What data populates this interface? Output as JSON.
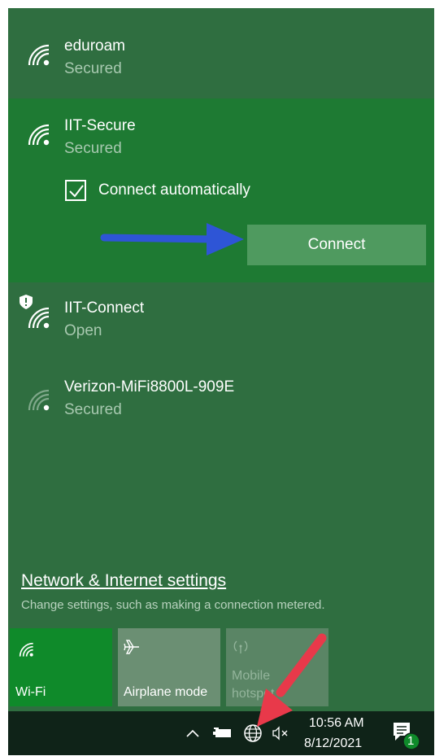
{
  "networks": [
    {
      "ssid": "eduroam",
      "status": "Secured"
    },
    {
      "ssid": "IIT-Secure",
      "status": "Secured"
    },
    {
      "ssid": "IIT-Connect",
      "status": "Open"
    },
    {
      "ssid": "Verizon-MiFi8800L-909E",
      "status": "Secured"
    }
  ],
  "selected": {
    "auto_connect_label": "Connect automatically",
    "auto_connect_checked": true,
    "connect_label": "Connect"
  },
  "settings": {
    "link": "Network & Internet settings",
    "description": "Change settings, such as making a connection metered."
  },
  "quick_actions": {
    "wifi_label": "Wi-Fi",
    "airplane_label": "Airplane mode",
    "mobile_label_line1": "Mobile",
    "mobile_label_line2": "hotspot"
  },
  "taskbar": {
    "time": "10:56 AM",
    "date": "8/12/2021",
    "notification_count": "1",
    "icons": [
      "chevron-up-icon",
      "battery-icon",
      "globe-network-icon",
      "speaker-muted-icon",
      "notification-icon"
    ]
  },
  "colors": {
    "flyout_bg": "#2f6e40",
    "selected_bg": "#1e7a33",
    "connect_button": "#4f9a5f",
    "wifi_tile_active": "#0f8a2a",
    "taskbar_bg": "#0f2318",
    "annotation_blue": "#2e55d6",
    "annotation_red": "#e8394a"
  }
}
